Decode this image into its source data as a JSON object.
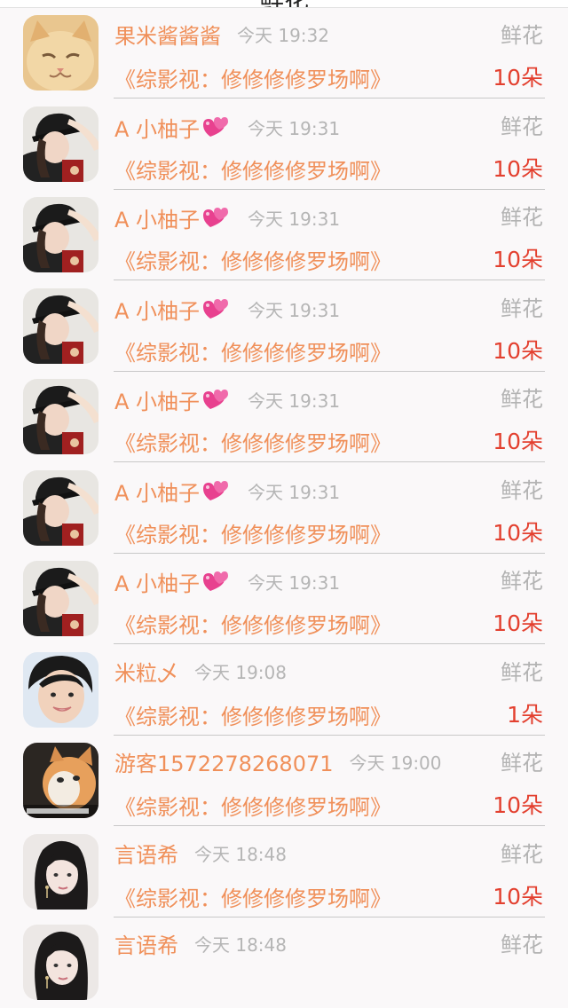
{
  "header": {
    "title": "鲜花"
  },
  "records": [
    {
      "avatar": "kitten-avatar",
      "name": "果米酱酱酱",
      "heart": false,
      "time": "今天 19:32",
      "gift": "鲜花",
      "message": "《综影视：修修修修罗场啊》",
      "count": "10朵"
    },
    {
      "avatar": "girl-cap-avatar",
      "name": "A 小柚子",
      "heart": true,
      "time": "今天 19:31",
      "gift": "鲜花",
      "message": "《综影视：修修修修罗场啊》",
      "count": "10朵"
    },
    {
      "avatar": "girl-cap-avatar",
      "name": "A 小柚子",
      "heart": true,
      "time": "今天 19:31",
      "gift": "鲜花",
      "message": "《综影视：修修修修罗场啊》",
      "count": "10朵"
    },
    {
      "avatar": "girl-cap-avatar",
      "name": "A 小柚子",
      "heart": true,
      "time": "今天 19:31",
      "gift": "鲜花",
      "message": "《综影视：修修修修罗场啊》",
      "count": "10朵"
    },
    {
      "avatar": "girl-cap-avatar",
      "name": "A 小柚子",
      "heart": true,
      "time": "今天 19:31",
      "gift": "鲜花",
      "message": "《综影视：修修修修罗场啊》",
      "count": "10朵"
    },
    {
      "avatar": "girl-cap-avatar",
      "name": "A 小柚子",
      "heart": true,
      "time": "今天 19:31",
      "gift": "鲜花",
      "message": "《综影视：修修修修罗场啊》",
      "count": "10朵"
    },
    {
      "avatar": "girl-cap-avatar",
      "name": "A 小柚子",
      "heart": true,
      "time": "今天 19:31",
      "gift": "鲜花",
      "message": "《综影视：修修修修罗场啊》",
      "count": "10朵"
    },
    {
      "avatar": "smiling-boy-avatar",
      "name": "米粒乄",
      "heart": false,
      "time": "今天 19:08",
      "gift": "鲜花",
      "message": "《综影视：修修修修罗场啊》",
      "count": "1朵"
    },
    {
      "avatar": "cat-photo-avatar",
      "name": "游客1572278268071",
      "heart": false,
      "time": "今天 19:00",
      "gift": "鲜花",
      "message": "《综影视：修修修修罗场啊》",
      "count": "10朵"
    },
    {
      "avatar": "dark-hair-girl-avatar",
      "name": "言语希",
      "heart": false,
      "time": "今天 18:48",
      "gift": "鲜花",
      "message": "《综影视：修修修修罗场啊》",
      "count": "10朵"
    },
    {
      "avatar": "dark-hair-girl-avatar",
      "name": "言语希",
      "heart": false,
      "time": "今天 18:48",
      "gift": "鲜花",
      "message": "",
      "count": ""
    }
  ],
  "colors": {
    "name": "#f0905a",
    "count": "#e3402f",
    "muted": "#b3b3b3",
    "background": "#faf8f9"
  }
}
